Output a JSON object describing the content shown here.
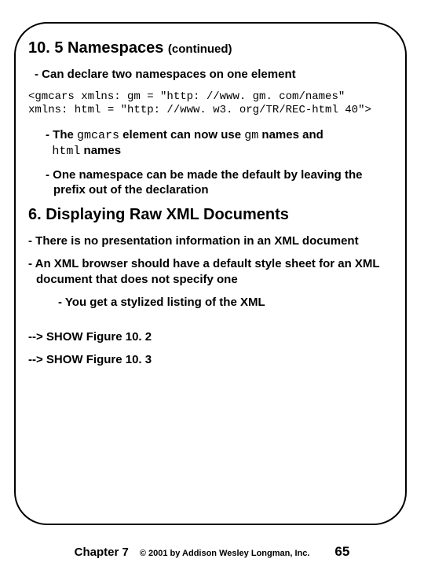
{
  "title_main": "10. 5 Namespaces",
  "title_sub": "(continued)",
  "point1": "- Can declare two namespaces on one element",
  "code_block": "<gmcars xmlns: gm = \"http: //www. gm. com/names\"\nxmlns: html = \"http: //www. w3. org/TR/REC-html 40\">",
  "point2_prefix": "- The ",
  "point2_code1": "gmcars",
  "point2_mid": " element can now use ",
  "point2_code2": "gm",
  "point2_suffix": " names and",
  "point2_line2_code": "html",
  "point2_line2_rest": " names",
  "point3": "- One namespace can be made the default by leaving the prefix out of the declaration",
  "section_heading": "6. Displaying Raw XML Documents",
  "point4": "- There is no presentation information in an XML document",
  "point5": "- An XML browser should have a default style sheet for an XML document that does not specify one",
  "point6": "- You get a stylized listing of the XML",
  "show1": "--> SHOW Figure 10. 2",
  "show2": "--> SHOW Figure 10. 3",
  "footer_chapter": "Chapter 7",
  "footer_copyright": "© 2001 by Addison Wesley Longman, Inc.",
  "footer_page": "65"
}
